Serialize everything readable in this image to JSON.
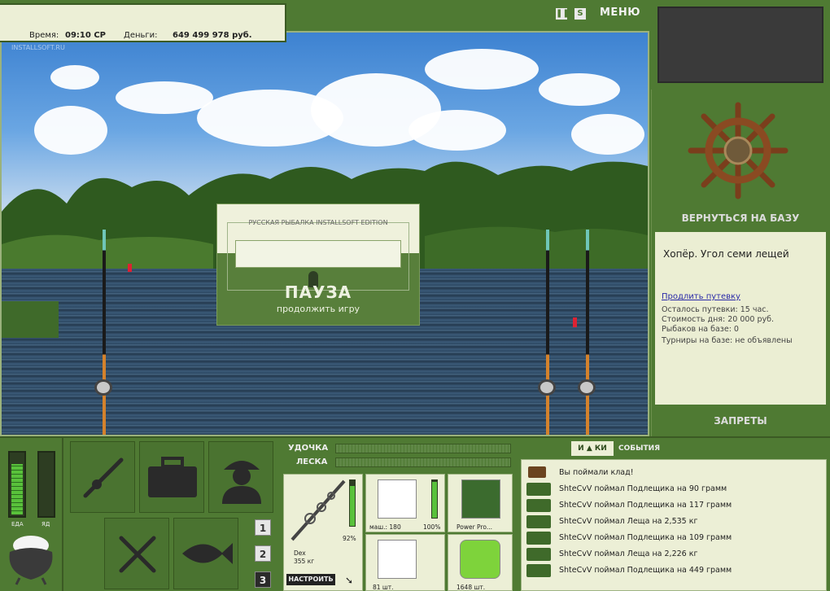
{
  "status": {
    "time_label": "Время:",
    "time_value": "09:10 СР",
    "money_label": "Деньги:",
    "money_value": "649 499 978 руб."
  },
  "toolbar": {
    "pause_icon": "pause-icon",
    "sound_icon": "S",
    "menu_label": "МЕНЮ"
  },
  "scene": {
    "watermark": "INSTALLSOFT.RU"
  },
  "pause_dialog": {
    "caption": "РУССКАЯ РЫБАЛКА INSTALLSOFT EDITION",
    "title": "ПАУЗА",
    "subtitle": "продолжить игру"
  },
  "right_panel": {
    "return_label": "ВЕРНУТЬСЯ НА БАЗУ",
    "location": "Хопёр. Угол семи лещей",
    "extend_link": "Продлить путевку",
    "info": [
      "Осталось путевки: 15 час.",
      "Стоимость дня: 20 000 руб.",
      "Рыбаков на базе: 0",
      "Турниры на базе: не объявлены"
    ],
    "bans_label": "ЗАПРЕТЫ"
  },
  "meters": {
    "food_label": "ЕДА",
    "poison_label": "ЯД",
    "food_level": 0.85,
    "poison_level": 0.0
  },
  "slot_buttons": [
    "1",
    "2",
    "3"
  ],
  "tackle": {
    "rod_label": "УДОЧКА",
    "line_label": "ЛЕСКА",
    "rod_name": "Dex",
    "rod_weight": "355 кг",
    "rod_percent": "92%",
    "reel_label": "маш.: 180",
    "reel_percent": "100%",
    "line_name": "Power Pro...",
    "hook_count": "81 шт.",
    "bait_count": "1648 шт.",
    "setup_label": "НАСТРОИТЬ",
    "rod_level": 0.92,
    "reel_level": 1.0
  },
  "events": {
    "header": "СОБЫТИЯ",
    "logo_left": "И",
    "logo_right": "КИ",
    "items": [
      {
        "icon": "chest-icon",
        "text": "Вы поймали клад!"
      },
      {
        "icon": "fish-icon",
        "text": "ShteCvV поймал Подлещика на 90 грамм"
      },
      {
        "icon": "fish-icon",
        "text": "ShteCvV поймал Подлещика на 117 грамм"
      },
      {
        "icon": "fish-icon",
        "text": "ShteCvV поймал Леща на 2,535 кг"
      },
      {
        "icon": "fish-icon",
        "text": "ShteCvV поймал Подлещика на 109 грамм"
      },
      {
        "icon": "fish-icon",
        "text": "ShteCvV поймал Леща на 2,226 кг"
      },
      {
        "icon": "fish-icon",
        "text": "ShteCvV поймал Подлещика на 449 грамм"
      }
    ]
  },
  "colors": {
    "panel_green": "#4f7a33",
    "panel_cream": "#ecefd6",
    "meter_green": "#59c13b"
  }
}
